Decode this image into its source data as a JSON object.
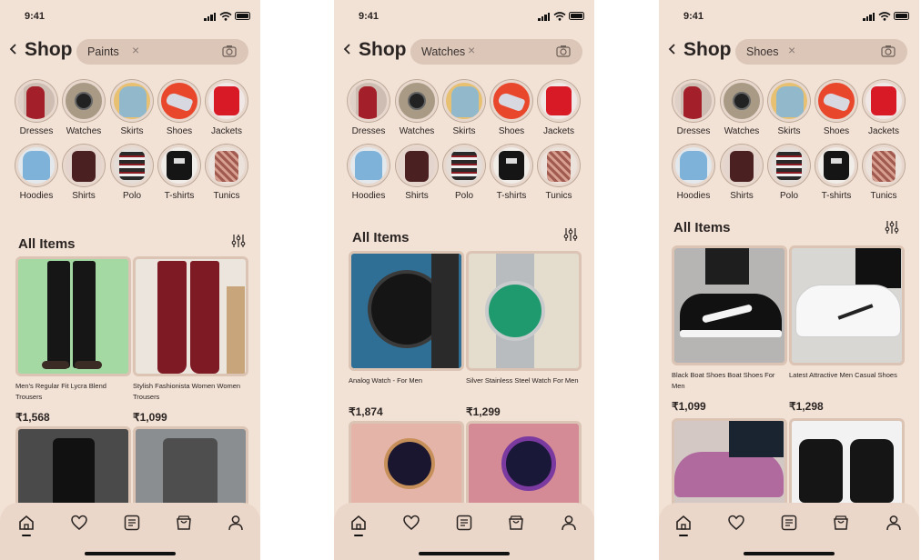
{
  "status": {
    "time": "9:41"
  },
  "shop_title": "Shop",
  "categories": [
    "Dresses",
    "Watches",
    "Skirts",
    "Shoes",
    "Jackets",
    "Hoodies",
    "Shirts",
    "Polo",
    "T-shirts",
    "Tunics"
  ],
  "section_title": "All Items",
  "currency_note": "₹",
  "screens": [
    {
      "search_value": "Paints",
      "products": [
        {
          "name": "Men's Regular Fit Lycra Blend Trousers",
          "price": "₹1,568"
        },
        {
          "name": "Stylish Fashionista Women Women Trousers",
          "price": "₹1,099"
        }
      ]
    },
    {
      "search_value": "Watches",
      "products": [
        {
          "name": "Analog Watch - For Men",
          "price": "₹1,874"
        },
        {
          "name": "Silver Stainless Steel Watch For Men",
          "price": "₹1,299"
        }
      ]
    },
    {
      "search_value": "Shoes",
      "products": [
        {
          "name": "Black Boat Shoes Boat Shoes For Men",
          "price": "₹1,099"
        },
        {
          "name": "Latest Attractive Men Casual Shoes",
          "price": "₹1,298"
        }
      ]
    }
  ],
  "nav": [
    "home-icon",
    "heart-icon",
    "list-icon",
    "bag-icon",
    "profile-icon"
  ],
  "colors": {
    "background": "#f2e1d5",
    "search": "#dbc6b8",
    "card_border": "#dcc4b4",
    "nav": "#ebd7c9"
  }
}
